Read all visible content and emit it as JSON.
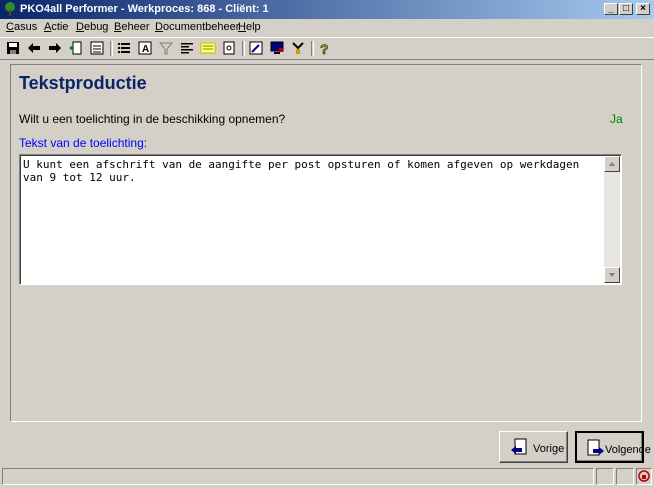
{
  "window": {
    "title": "PKO4all Performer - Werkproces: 868 - Cliënt: 1"
  },
  "menu": [
    {
      "u": "C",
      "rest": "asus"
    },
    {
      "u": "A",
      "rest": "ctie"
    },
    {
      "u": "D",
      "rest": "ebug"
    },
    {
      "u": "B",
      "rest": "eheer"
    },
    {
      "u": "D",
      "rest": "ocumentbeheer"
    },
    {
      "u": "H",
      "rest": "elp"
    }
  ],
  "toolbar_icons": [
    "save-icon",
    "back-arrow-icon",
    "forward-arrow-icon",
    "document-arrow-icon",
    "calendar-icon",
    "list-icon",
    "text-a-icon",
    "filter-icon",
    "align-icon",
    "highlight-icon",
    "page-icon",
    "edit-form-icon",
    "monitor-icon",
    "tools-icon",
    "help-icon"
  ],
  "page": {
    "title": "Tekstproductie",
    "question": "Wilt u een toelichting in de beschikking opnemen?",
    "answer": "Ja",
    "toelichting_label": "Tekst van de toelichting:",
    "toelichting_text": "U kunt een afschrift van de aangifte per post opsturen of komen afgeven op werkdagen van 9 tot 12 uur."
  },
  "buttons": {
    "prev_label": "Vorige",
    "next_label": "Volgende"
  },
  "colors": {
    "title_blue": "#0a246a",
    "label_blue": "#0000ff",
    "answer_green": "#008000"
  }
}
